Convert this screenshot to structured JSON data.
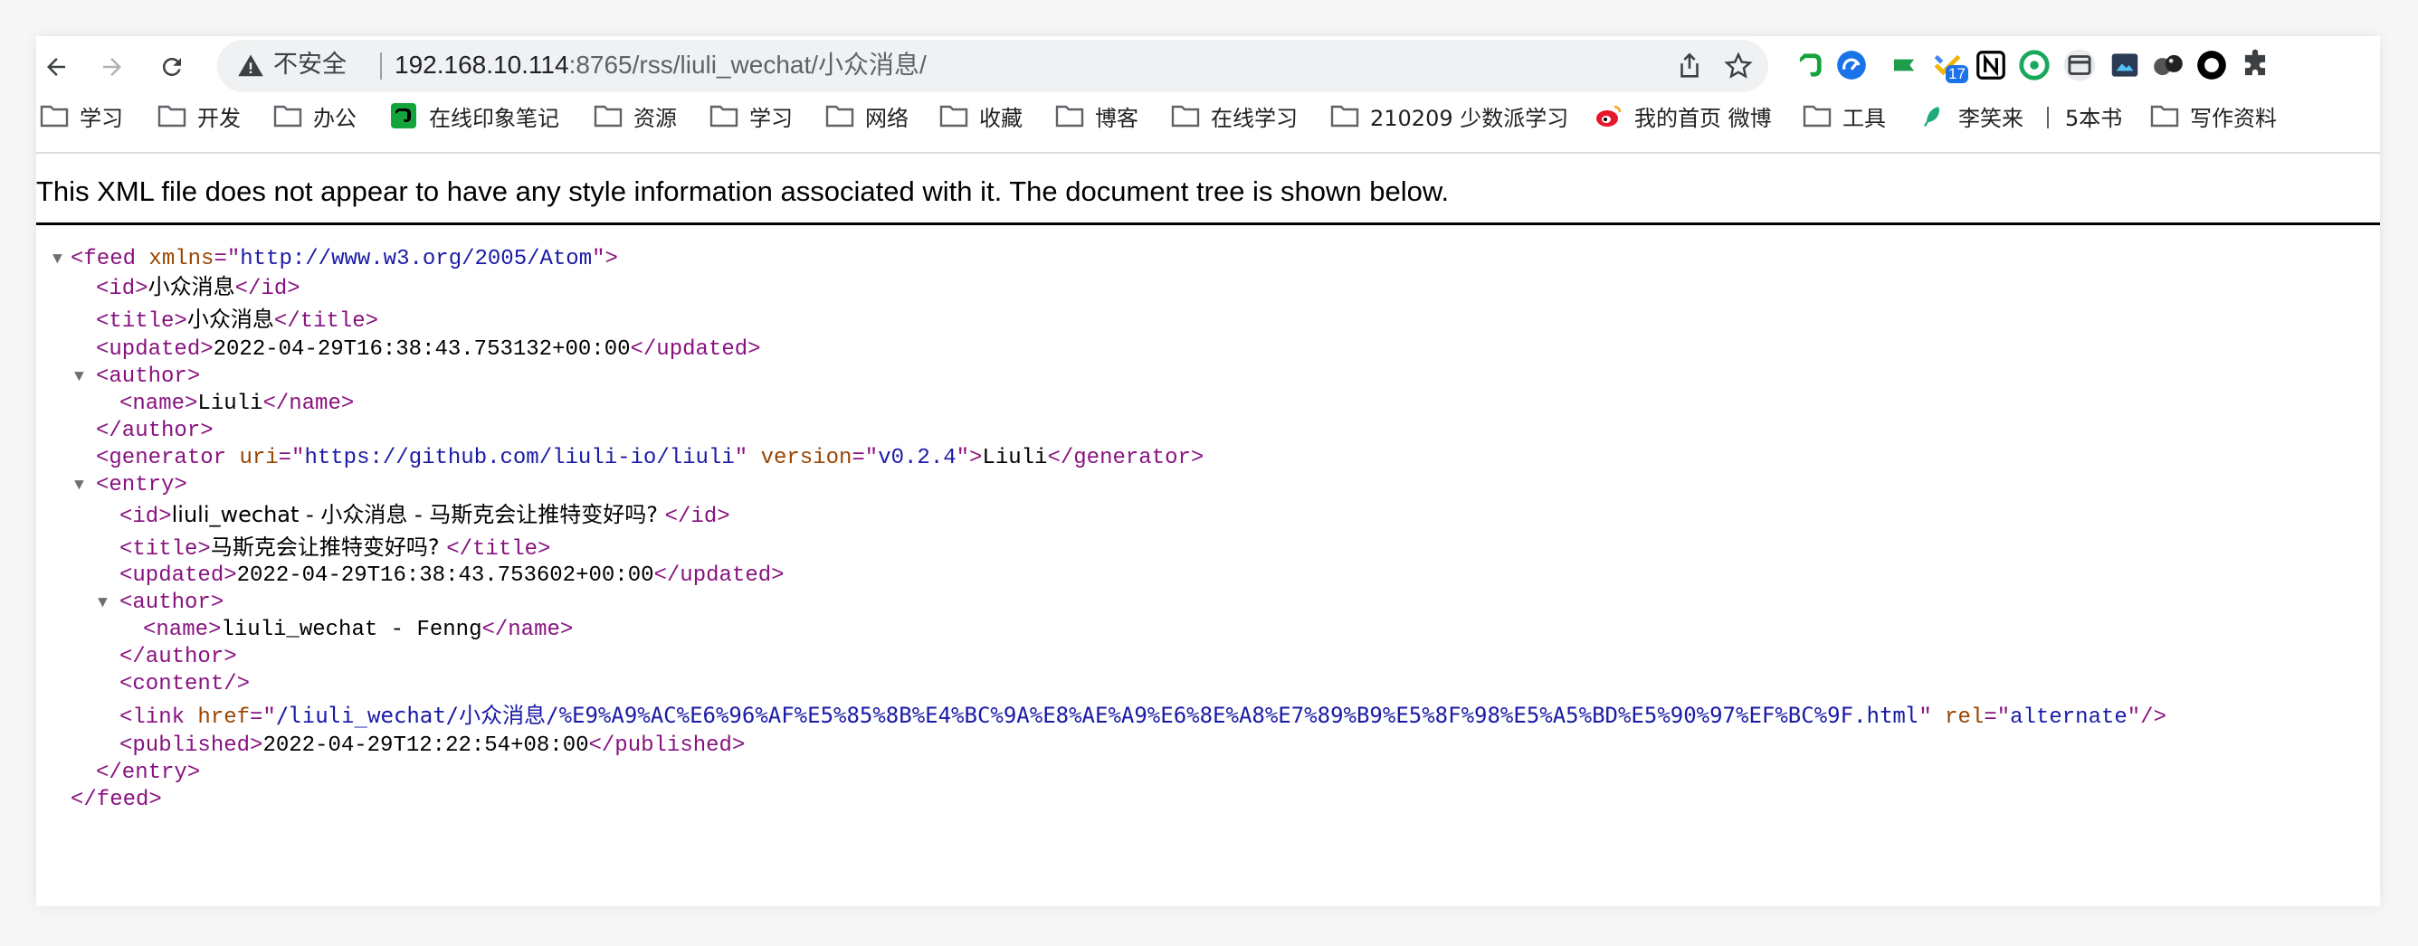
{
  "browser": {
    "security_label": "不安全",
    "url_host": "192.168.10.114",
    "url_rest": ":8765/rss/liuli_wechat/小众消息/"
  },
  "bookmarks": [
    {
      "label": "学习",
      "icon": "folder-icon"
    },
    {
      "label": "开发",
      "icon": "folder-icon"
    },
    {
      "label": "办公",
      "icon": "folder-icon"
    },
    {
      "label": "在线印象笔记",
      "icon": "evernote-icon"
    },
    {
      "label": "资源",
      "icon": "folder-icon"
    },
    {
      "label": "学习",
      "icon": "folder-icon"
    },
    {
      "label": "网络",
      "icon": "folder-icon"
    },
    {
      "label": "收藏",
      "icon": "folder-icon"
    },
    {
      "label": "博客",
      "icon": "folder-icon"
    },
    {
      "label": "在线学习",
      "icon": "folder-icon"
    },
    {
      "label": "210209 少数派学习",
      "icon": "folder-icon"
    },
    {
      "label": "我的首页 微博",
      "icon": "weibo-icon"
    },
    {
      "label": "工具",
      "icon": "folder-icon"
    },
    {
      "label": "李笑来",
      "icon": "feather-icon"
    },
    {
      "label": "5本书",
      "icon": "none"
    },
    {
      "label": "写作资料",
      "icon": "folder-icon"
    }
  ],
  "extensions": {
    "calendar_badge": "17"
  },
  "xml_notice": "This XML file does not appear to have any style information associated with it. The document tree is shown below.",
  "feed": {
    "xmlns": "http://www.w3.org/2005/Atom",
    "id": "小众消息",
    "title": "小众消息",
    "updated": "2022-04-29T16:38:43.753132+00:00",
    "author_name": "Liuli",
    "generator_uri": "https://github.com/liuli-io/liuli",
    "generator_version": "v0.2.4",
    "generator_text": "Liuli",
    "entry": {
      "id": "liuli_wechat - 小众消息 - 马斯克会让推特变好吗? ",
      "title": "马斯克会让推特变好吗? ",
      "updated": "2022-04-29T16:38:43.753602+00:00",
      "author_name": "liuli_wechat - Fenng",
      "link_href": "/liuli_wechat/小众消息/%E9%A9%AC%E6%96%AF%E5%85%8B%E4%BC%9A%E8%AE%A9%E6%8E%A8%E7%89%B9%E5%8F%98%E5%A5%BD%E5%90%97%EF%BC%9F.html",
      "link_rel": "alternate",
      "published": "2022-04-29T12:22:54+08:00"
    }
  },
  "colors": {
    "tag": "#881280",
    "attr_name": "#994500",
    "attr_value": "#1a1aa6"
  }
}
